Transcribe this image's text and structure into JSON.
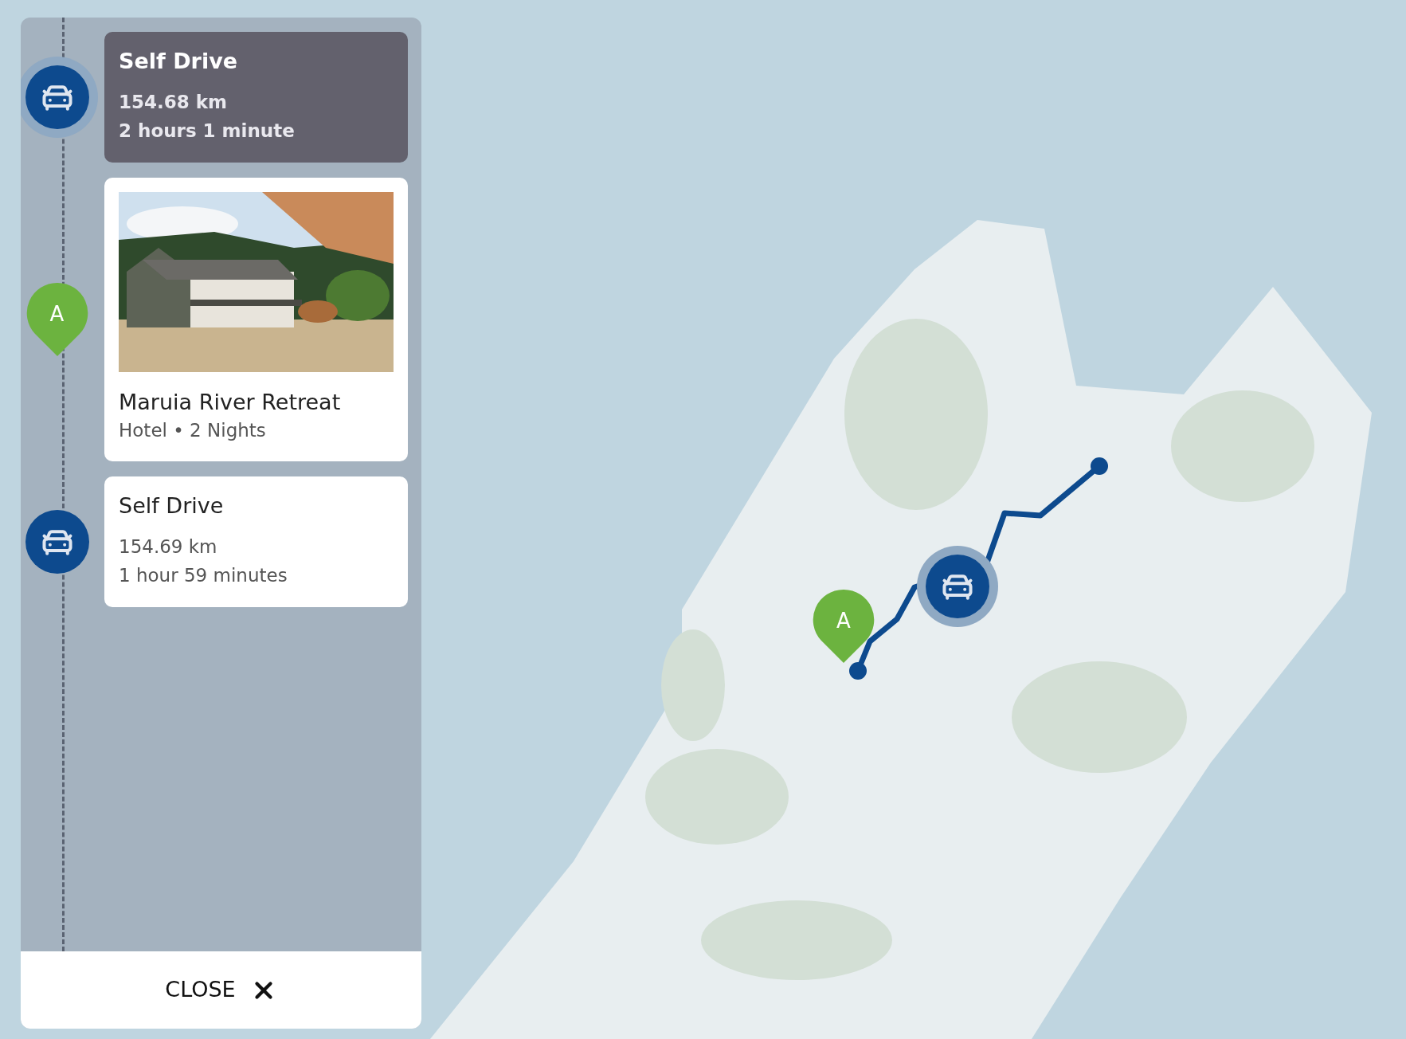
{
  "itinerary": [
    {
      "kind": "drive",
      "selected": true,
      "title": "Self Drive",
      "distance": "154.68 km",
      "duration": "2 hours 1 minute"
    },
    {
      "kind": "stay",
      "marker": "A",
      "title": "Maruia River Retreat",
      "details": "Hotel • 2 Nights"
    },
    {
      "kind": "drive",
      "selected": false,
      "title": "Self Drive",
      "distance": "154.69 km",
      "duration": "1 hour 59 minutes"
    }
  ],
  "close_button": {
    "label": "CLOSE"
  },
  "map": {
    "markers": [
      {
        "kind": "stay",
        "label": "A"
      },
      {
        "kind": "drive"
      }
    ]
  }
}
